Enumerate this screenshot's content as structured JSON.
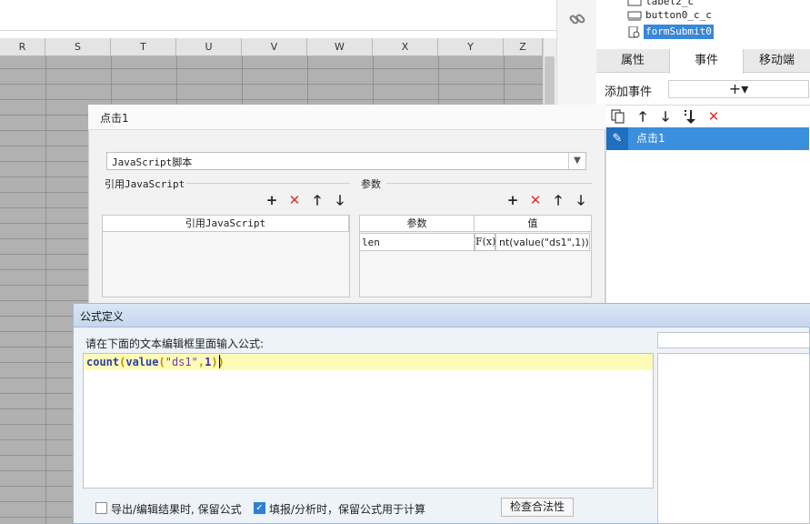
{
  "sheet": {
    "columns": [
      "R",
      "S",
      "T",
      "U",
      "V",
      "W",
      "X",
      "Y",
      "Z"
    ]
  },
  "side_icons": {
    "link": "link-icon"
  },
  "tree": {
    "items": [
      {
        "label": "label2_c",
        "icon": "label-icon"
      },
      {
        "label": "button0_c_c",
        "icon": "button-icon"
      },
      {
        "label": "formSubmit0",
        "icon": "form-submit-icon",
        "selected": true
      }
    ]
  },
  "property_tabs": [
    {
      "label": "属性"
    },
    {
      "label": "事件",
      "active": true
    },
    {
      "label": "移动端"
    }
  ],
  "events_panel": {
    "add_event_label": "添加事件",
    "add_button_glyph": "+▾",
    "toolbar_icons": [
      "copy-icon",
      "arrow-up-icon",
      "arrow-down-icon",
      "move-bottom-icon",
      "delete-icon"
    ],
    "items": [
      {
        "label": "点击1",
        "icon": "pencil-icon"
      }
    ]
  },
  "event_dialog": {
    "title": "点击1",
    "script_type": "JavaScript脚本",
    "ref_js": {
      "section_label": "引用JavaScript",
      "column_header": "引用JavaScript",
      "toolbar_icons": [
        "plus-icon",
        "delete-icon",
        "arrow-up-icon",
        "arrow-down-icon"
      ]
    },
    "params": {
      "section_label": "参数",
      "headers": [
        "参数",
        "值"
      ],
      "rows": [
        {
          "name": "len",
          "value": "nt(value(\"ds1\",1))"
        }
      ],
      "toolbar_icons": [
        "plus-icon",
        "delete-icon",
        "arrow-up-icon",
        "arrow-down-icon"
      ],
      "fx_label": "F(x)"
    }
  },
  "formula_dialog": {
    "title": "公式定义",
    "prompt": "请在下面的文本编辑框里面输入公式:",
    "tokens": {
      "t1": "count",
      "t2": "(",
      "t3": "value",
      "t4": "(",
      "t5": "\"ds1\"",
      "t6": ",",
      "t7": "1",
      "t8": "))"
    },
    "option_export": {
      "label": "导出/编辑结果时, 保留公式",
      "checked": false
    },
    "option_fill": {
      "label": "填报/分析时，保留公式用于计算",
      "checked": true
    },
    "check_button": "检查合法性"
  },
  "colors": {
    "accent": "#3b8fdd",
    "danger": "#e0302a",
    "highlight_line": "#fdfbb8"
  }
}
